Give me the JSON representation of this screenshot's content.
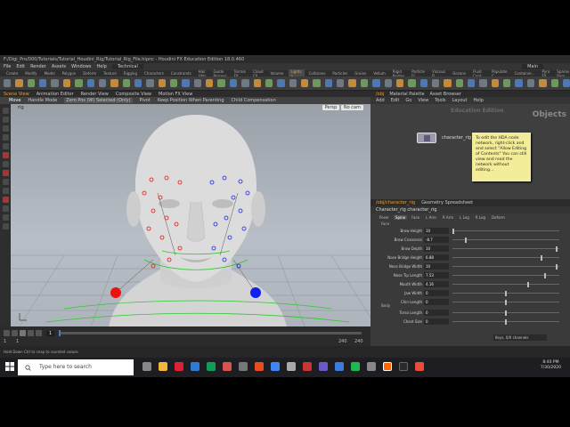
{
  "window": {
    "title": "F:/Digi_Pro/000/Tutorials/Tutorial_Houdini_Rig/Tutorial_Rig_File.hipnc - Houdini FX Education Edition 18.0.460"
  },
  "menus": [
    "File",
    "Edit",
    "Render",
    "Assets",
    "Windows",
    "Help"
  ],
  "desktop_label": "Technical",
  "workspace": "Main",
  "shelf_tabs": [
    {
      "label": "Create",
      "active": false
    },
    {
      "label": "Modify",
      "active": false
    },
    {
      "label": "Model",
      "active": false
    },
    {
      "label": "Polygon",
      "active": false
    },
    {
      "label": "Deform",
      "active": false
    },
    {
      "label": "Texture",
      "active": false
    },
    {
      "label": "Rigging",
      "active": false
    },
    {
      "label": "Characters",
      "active": false
    },
    {
      "label": "Constraints",
      "active": false
    },
    {
      "label": "Hair Utils",
      "active": false
    },
    {
      "label": "Guide Process",
      "active": false
    },
    {
      "label": "Terrain FX",
      "active": false
    },
    {
      "label": "Cloud FX",
      "active": false
    },
    {
      "label": "Volume",
      "active": false
    },
    {
      "label": "Lights a...",
      "active": true
    },
    {
      "label": "Collisions",
      "active": false
    },
    {
      "label": "Particles",
      "active": false
    },
    {
      "label": "Grains",
      "active": false
    },
    {
      "label": "Vellum",
      "active": false
    },
    {
      "label": "Rigid Bodies",
      "active": false
    },
    {
      "label": "Particle Fl...",
      "active": false
    },
    {
      "label": "Viscous Fl...",
      "active": false
    },
    {
      "label": "Oceans",
      "active": false
    },
    {
      "label": "Fluid Cont...",
      "active": false
    },
    {
      "label": "Populate C...",
      "active": false
    },
    {
      "label": "Container...",
      "active": false
    },
    {
      "label": "Pyro FX",
      "active": false
    },
    {
      "label": "Sparse Pyro",
      "active": false
    },
    {
      "label": "FEM",
      "active": false
    },
    {
      "label": "Wires",
      "active": false
    },
    {
      "label": "Crowds",
      "active": false
    },
    {
      "label": "Drive Sim",
      "active": false
    }
  ],
  "left_pane_tabs": [
    "Scene View",
    "Animation Editor",
    "Render View",
    "Composite View",
    "Motion FX View"
  ],
  "viewport_toolbar": [
    "Move",
    "Handle Mode",
    "Zero Pos (W) Selected (Only)",
    "Pivot",
    "Keep Position When Parenting",
    "Child Compensation"
  ],
  "viewport": {
    "path_label": "rig",
    "camera_label": "Persp",
    "camera2_label": "No cam"
  },
  "timeline": {
    "frame": "1",
    "start": "1",
    "end": "240",
    "end2": "240"
  },
  "status": "Hold Down Ctrl to snap to rounded values",
  "right_pane_tabs": [
    "/obj",
    "Material Palette",
    "Asset Browser"
  ],
  "right_pane_menu": [
    "Add",
    "Edit",
    "Go",
    "View",
    "Tools",
    "Layout",
    "Help"
  ],
  "network": {
    "title": "Education Edition",
    "context": "Objects",
    "node_label": "character_rig",
    "sticky_note": "To edit the HDA node network, right-click and and select \"Allow Editing of Contents\" You can still view and read the network without editing..."
  },
  "param_pane_tabs": [
    "/obj/character_rig",
    "Geometry Spreadsheet"
  ],
  "param_header": "Character_rig    character_rig",
  "param_subtabs": [
    {
      "label": "Poser",
      "active": false
    },
    {
      "label": "Spine",
      "active": true
    },
    {
      "label": "Face",
      "active": false
    },
    {
      "label": "L Arm",
      "active": false
    },
    {
      "label": "R Arm",
      "active": false
    },
    {
      "label": "L Leg",
      "active": false
    },
    {
      "label": "R Leg",
      "active": false
    },
    {
      "label": "Deform",
      "active": false
    }
  ],
  "param_sections": {
    "face": "Face",
    "body": "Body"
  },
  "params": [
    {
      "label": "Brow Height",
      "value": "10",
      "slider": 0.0
    },
    {
      "label": "Brow Crossness",
      "value": "-8.7",
      "slider": 0.12
    },
    {
      "label": "Brow Depth",
      "value": "10",
      "slider": 0.98
    },
    {
      "label": "Nose Bridge Height",
      "value": "6.88",
      "slider": 0.84
    },
    {
      "label": "Nose Bridge Width",
      "value": "10",
      "slider": 0.98
    },
    {
      "label": "Nose Tip Length",
      "value": "7.53",
      "slider": 0.87
    },
    {
      "label": "Mouth Width",
      "value": "4.16",
      "slider": 0.71
    },
    {
      "label": "Jaw Width",
      "value": "0",
      "slider": 0.5
    },
    {
      "label": "Chin Length",
      "value": "0",
      "slider": 0.5
    }
  ],
  "body_params": [
    {
      "label": "Torso Length",
      "value": "0",
      "slider": 0.5
    },
    {
      "label": "Chest Size",
      "value": "0",
      "slider": 0.5
    }
  ],
  "right_footer": [
    "Keys, 0/0 channels",
    "Key All Channels",
    "Auto Update"
  ],
  "taskbar": {
    "search_placeholder": "Type here to search",
    "time": "8:40 PM",
    "date": "7/30/2020"
  },
  "colors": {
    "accent": "#e89c3c",
    "sticky": "#f3ec9a",
    "handle_red": "#e81010",
    "handle_blue": "#1a22e8"
  }
}
